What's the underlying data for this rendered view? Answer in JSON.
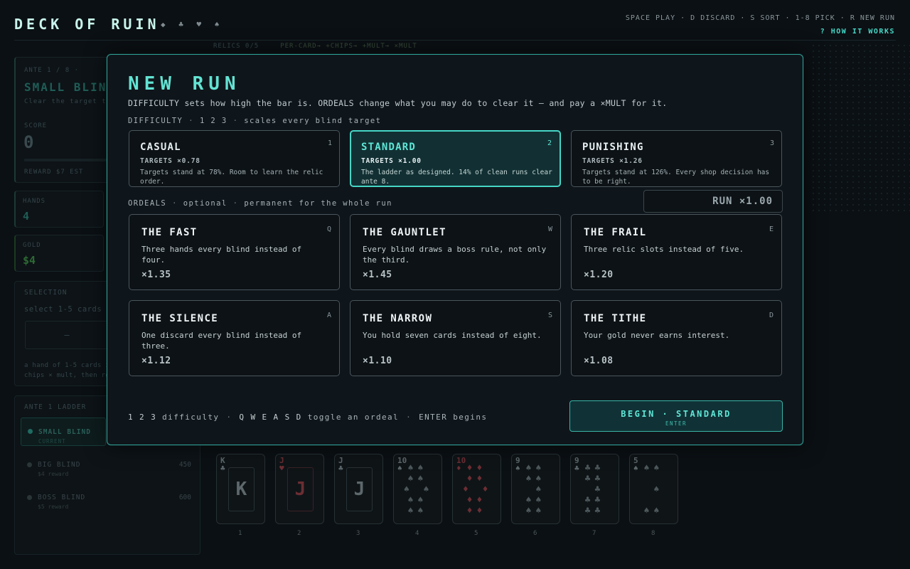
{
  "app": {
    "logo": "DECK OF RUIN",
    "logo_suits": "◆ ♣ ♥ ♠",
    "keys_hint": "SPACE PLAY  ·  D DISCARD  ·  S SORT  ·  1-8 PICK  ·  R NEW RUN",
    "how_it_works": "? HOW IT WORKS",
    "relics_label": "RELICS  0/5",
    "relics_tip": "PER-CARD→ +CHIPS→ +MULT→ ×MULT"
  },
  "left_panel": {
    "ante_label": "ANTE 1 / 8   ·",
    "blind_name": "SMALL BLIND",
    "blind_desc": "Clear the target to b",
    "score_label": "SCORE",
    "score_value": "0",
    "reward_label": "REWARD  $7  EST",
    "hands_label": "HANDS",
    "hands_value": "4",
    "gold_label": "GOLD",
    "gold_value": "$4",
    "selection_label": "SELECTION",
    "selection_hint": "select 1-5 cards",
    "selection_dash": "—",
    "help_line1": "a hand of 1-5 cards i",
    "help_line2": "chips × mult, then re",
    "ladder_label": "ANTE 1 LADDER",
    "ladder": [
      {
        "name": "SMALL BLIND",
        "sub": "CURRENT",
        "target": ""
      },
      {
        "name": "BIG BLIND",
        "sub": "$4 reward",
        "target": "450"
      },
      {
        "name": "BOSS BLIND",
        "sub": "$5 reward",
        "target": "600"
      }
    ]
  },
  "hand": [
    {
      "rank": "K",
      "suit": "♣",
      "red": false,
      "num": "1",
      "face": "K"
    },
    {
      "rank": "J",
      "suit": "♥",
      "red": true,
      "num": "2",
      "face": "J"
    },
    {
      "rank": "J",
      "suit": "♣",
      "red": false,
      "num": "3",
      "face": "J"
    },
    {
      "rank": "10",
      "suit": "♠",
      "red": false,
      "num": "4",
      "face": ""
    },
    {
      "rank": "10",
      "suit": "♦",
      "red": true,
      "num": "5",
      "face": ""
    },
    {
      "rank": "9",
      "suit": "♠",
      "red": false,
      "num": "6",
      "face": ""
    },
    {
      "rank": "9",
      "suit": "♣",
      "red": false,
      "num": "7",
      "face": ""
    },
    {
      "rank": "5",
      "suit": "♠",
      "red": false,
      "num": "8",
      "face": ""
    }
  ],
  "modal": {
    "title": "NEW RUN",
    "subtitle": "DIFFICULTY sets how high the bar is.  ORDEALS change what you may do to clear it — and pay a ×MULT for it.",
    "difficulty_label": "DIFFICULTY",
    "difficulty_keys": "1 2 3",
    "difficulty_note": "scales every blind target",
    "difficulties": [
      {
        "name": "CASUAL",
        "key": "1",
        "targets": "TARGETS ×0.78",
        "desc": "Targets stand at 78%. Room to learn the relic order.",
        "selected": false
      },
      {
        "name": "STANDARD",
        "key": "2",
        "targets": "TARGETS ×1.00",
        "desc": "The ladder as designed. 14% of clean runs clear ante 8.",
        "selected": true
      },
      {
        "name": "PUNISHING",
        "key": "3",
        "targets": "TARGETS ×1.26",
        "desc": "Targets stand at 126%. Every shop decision has to be right.",
        "selected": false
      }
    ],
    "ordeals_label": "ORDEALS",
    "ordeals_optional": "optional",
    "ordeals_note": "permanent for the whole run",
    "run_mult": "RUN ×1.00",
    "ordeals": [
      {
        "name": "THE FAST",
        "key": "Q",
        "desc": "Three hands every blind instead of four.",
        "mult": "×1.35"
      },
      {
        "name": "THE GAUNTLET",
        "key": "W",
        "desc": "Every blind draws a boss rule, not only the third.",
        "mult": "×1.45"
      },
      {
        "name": "THE FRAIL",
        "key": "E",
        "desc": "Three relic slots instead of five.",
        "mult": "×1.20"
      },
      {
        "name": "THE SILENCE",
        "key": "A",
        "desc": "One discard every blind instead of three.",
        "mult": "×1.12"
      },
      {
        "name": "THE NARROW",
        "key": "S",
        "desc": "You hold seven cards instead of eight.",
        "mult": "×1.10"
      },
      {
        "name": "THE TITHE",
        "key": "D",
        "desc": "Your gold never earns interest.",
        "mult": "×1.08"
      }
    ],
    "hint_diff_keys": "1 2 3",
    "hint_diff": "difficulty",
    "hint_ordeal_keys": "Q W E A S D",
    "hint_ordeal": "toggle an ordeal",
    "hint_enter": "ENTER begins",
    "begin_label": "BEGIN  ·  STANDARD",
    "begin_sub": "ENTER"
  },
  "colors": {
    "accent": "#45d6c6",
    "background": "#0b1014",
    "red_suit": "#6b2e33"
  }
}
